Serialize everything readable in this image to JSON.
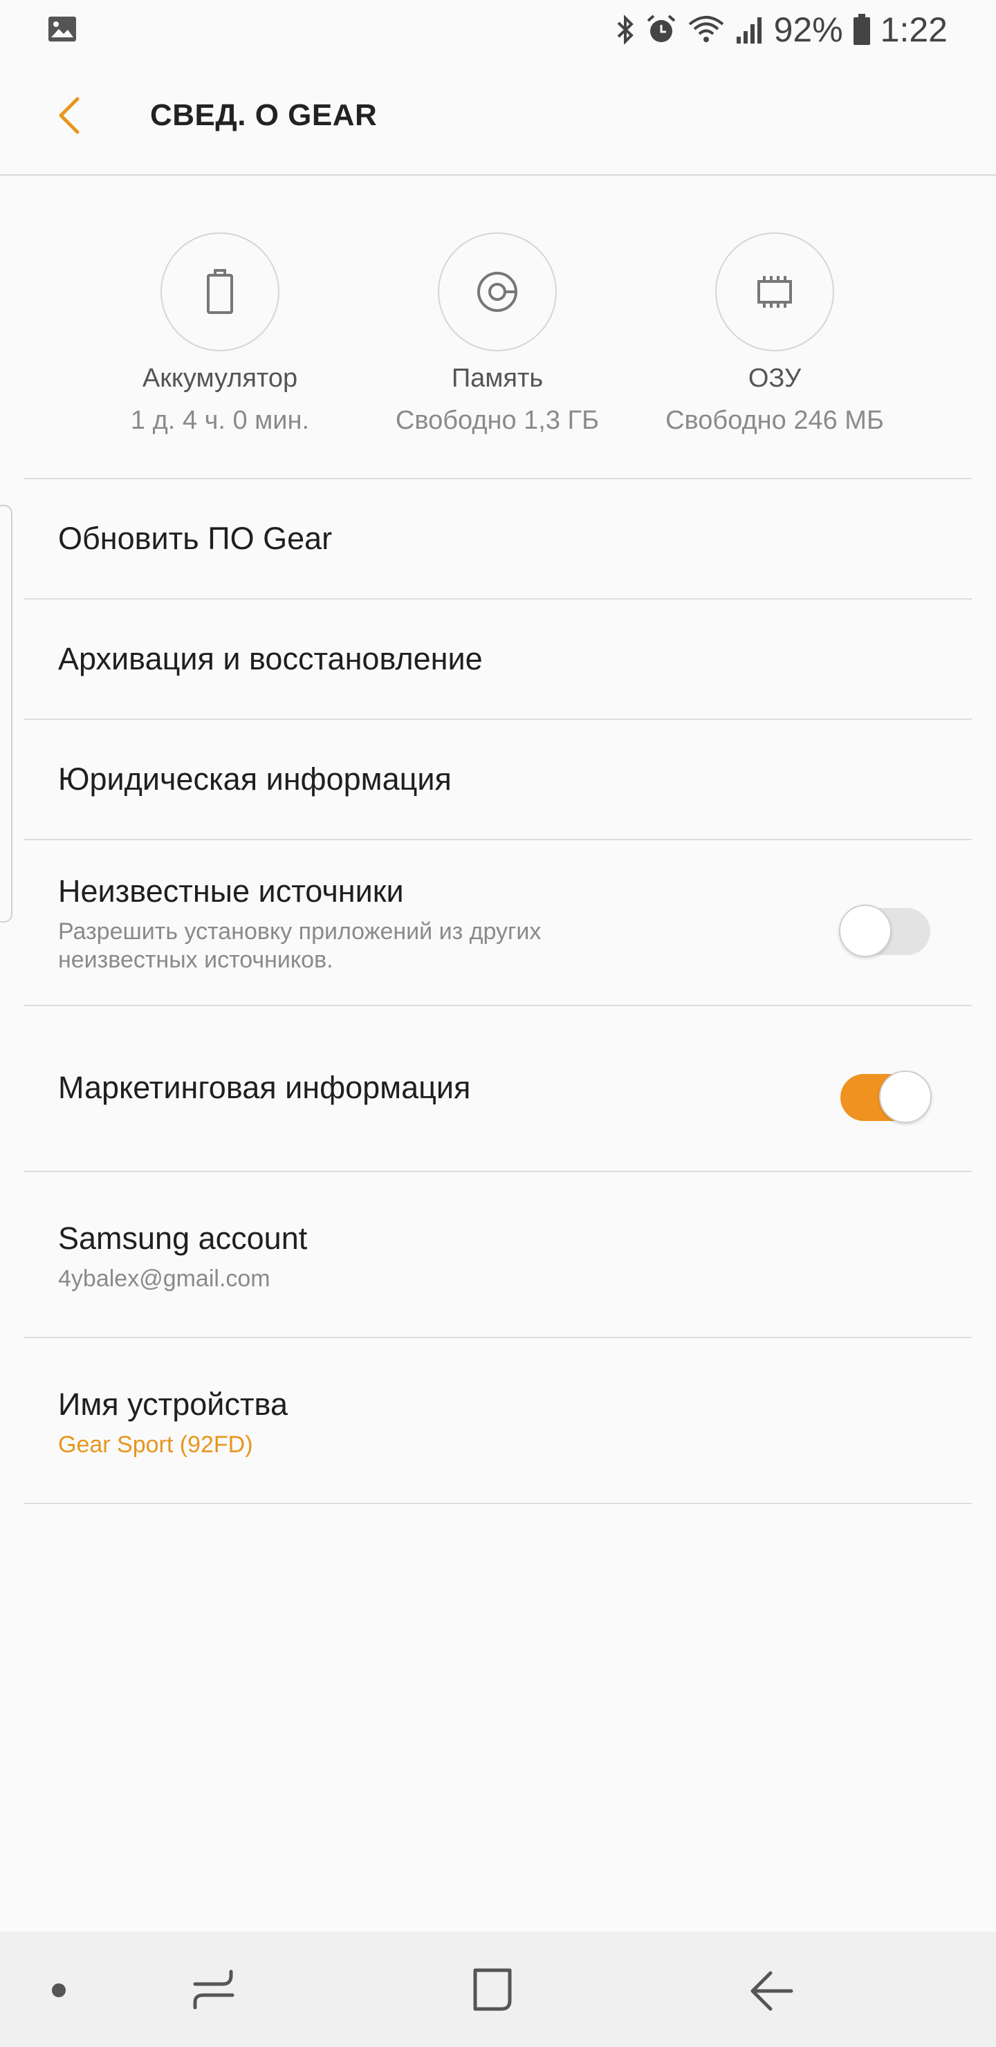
{
  "status_bar": {
    "battery_percent": "92%",
    "time": "1:22"
  },
  "header": {
    "title": "СВЕД. О GEAR"
  },
  "stats": [
    {
      "name": "Аккумулятор",
      "value": "1 д. 4 ч. 0 мин.",
      "icon": "battery-icon"
    },
    {
      "name": "Память",
      "value": "Свободно 1,3 ГБ",
      "icon": "storage-icon"
    },
    {
      "name": "ОЗУ",
      "value": "Свободно 246 МБ",
      "icon": "ram-chip-icon"
    }
  ],
  "items": {
    "update": {
      "title": "Обновить ПО Gear"
    },
    "backup": {
      "title": "Архивация и восстановление"
    },
    "legal": {
      "title": "Юридическая информация"
    },
    "unknown_sources": {
      "title": "Неизвестные источники",
      "subtitle": "Разрешить установку приложений из других неизвестных источников.",
      "enabled": false
    },
    "marketing": {
      "title": "Маркетинговая информация",
      "enabled": true
    },
    "account": {
      "title": "Samsung account",
      "subtitle": "4ybalex@gmail.com"
    },
    "device_name": {
      "title": "Имя устройства",
      "subtitle": "Gear Sport (92FD)"
    }
  },
  "colors": {
    "accent": "#f0921f",
    "background": "#fafafa",
    "navbar": "#f0f0f0"
  }
}
